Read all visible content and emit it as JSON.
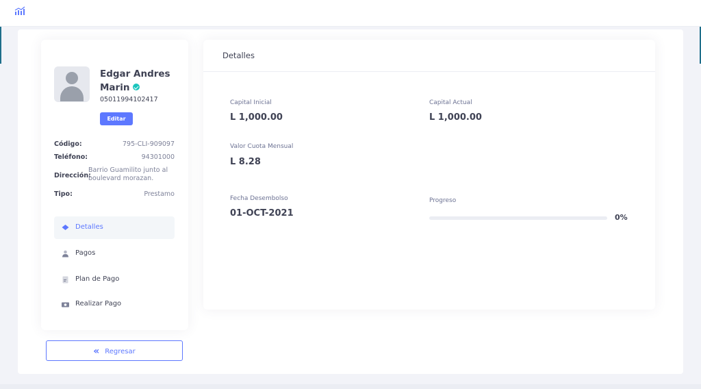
{
  "icons": {
    "logo": "chart-logo-icon",
    "verified": "verified-badge-icon",
    "avatar": "user-avatar-icon",
    "back": "double-chevron-left-icon"
  },
  "colors": {
    "accent": "#5d78ff",
    "verified": "#1bc5bd",
    "edge": "#1f6f8b"
  },
  "profile": {
    "name": "Edgar Andres Marin",
    "id_number": "05011994102417",
    "edit_label": "Editar",
    "info": [
      {
        "label": "Código:",
        "value": "795-CLI-909097"
      },
      {
        "label": "Teléfono:",
        "value": "94301000"
      },
      {
        "label": "Dirección:",
        "value": "Barrio Guamilito junto al boulevard morazan."
      },
      {
        "label": "Tipo:",
        "value": "Prestamo"
      }
    ]
  },
  "nav": {
    "items": [
      {
        "label": "Detalles",
        "icon": "layers-icon",
        "active": true
      },
      {
        "label": "Pagos",
        "icon": "user-icon",
        "active": false
      },
      {
        "label": "Plan de Pago",
        "icon": "document-icon",
        "active": false
      },
      {
        "label": "Realizar Pago",
        "icon": "money-icon",
        "active": false
      }
    ]
  },
  "back_label": "Regresar",
  "details": {
    "title": "Detalles",
    "capital_inicial_label": "Capital Inicial",
    "capital_inicial_value": "L 1,000.00",
    "capital_actual_label": "Capital Actual",
    "capital_actual_value": "L 1,000.00",
    "cuota_label": "Valor Cuota Mensual",
    "cuota_value": "L 8.28",
    "fecha_label": "Fecha Desembolso",
    "fecha_value": "01-OCT-2021",
    "progreso_label": "Progreso",
    "progreso_value": "0%",
    "progreso_percent": 0
  }
}
